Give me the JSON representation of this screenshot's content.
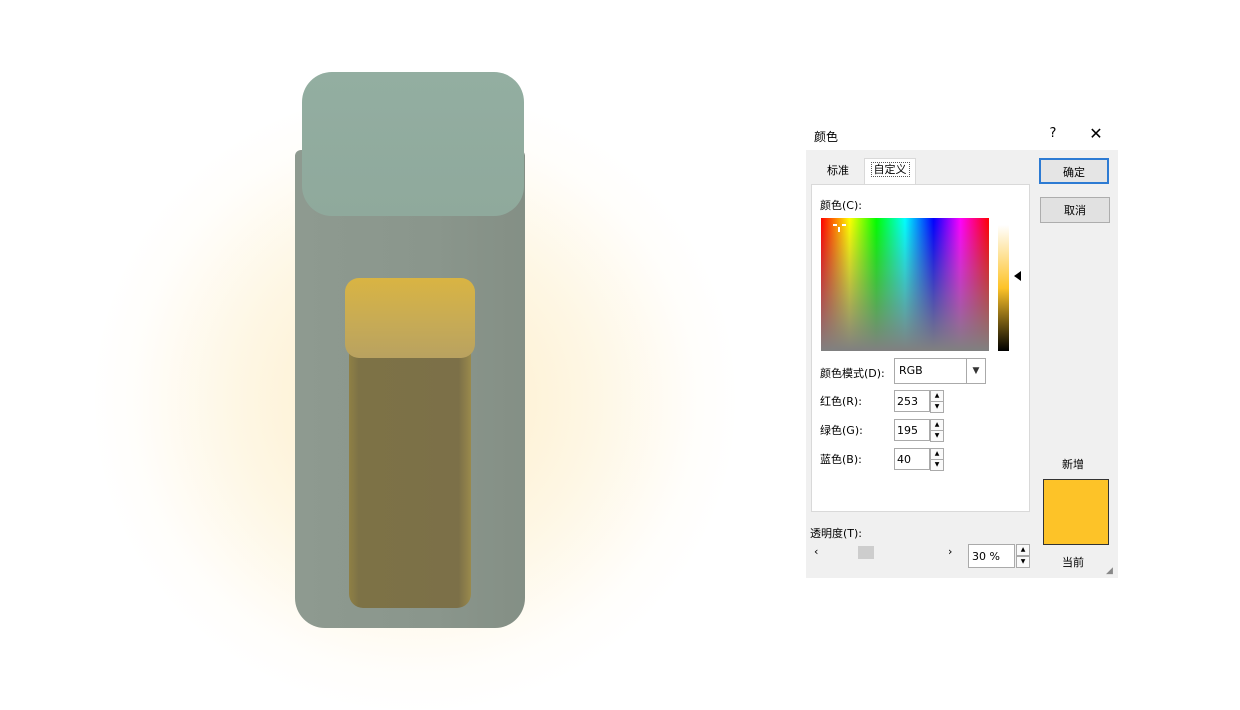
{
  "dialog": {
    "title": "颜色",
    "help": "?",
    "close": "✕",
    "tabs": [
      "标准",
      "自定义"
    ],
    "colors_label": "颜色(C):",
    "mode_label": "颜色模式(D):",
    "mode_value": "RGB",
    "red_label": "红色(R):",
    "red_value": "253",
    "green_label": "绿色(G):",
    "green_value": "195",
    "blue_label": "蓝色(B):",
    "blue_value": "40",
    "ok": "确定",
    "cancel": "取消",
    "new_label": "新增",
    "current_label": "当前",
    "transparency_label": "透明度(T):",
    "transparency_value": "30 %",
    "transparency_fraction": 0.3,
    "selected_color": "#fdc328"
  }
}
